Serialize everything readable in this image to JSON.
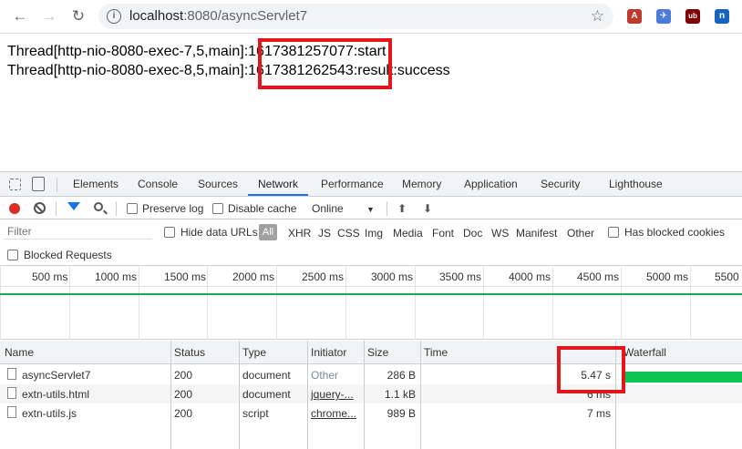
{
  "browser": {
    "url_host": "localhost",
    "url_path": ":8080/asyncServlet7",
    "back_glyph": "←",
    "forward_glyph": "→",
    "reload_glyph": "↻",
    "info_glyph": "i",
    "star_glyph": "☆",
    "extensions": [
      {
        "icon": "pdf-extension-icon",
        "color": "#c0392b",
        "glyph": "A"
      },
      {
        "icon": "vpn-extension-icon",
        "color": "#4a7bdc",
        "glyph": "✈"
      },
      {
        "icon": "ublock-extension-icon",
        "color": "#800000",
        "glyph": "ub"
      },
      {
        "icon": "app-extension-icon",
        "color": "#1565c0",
        "glyph": "n"
      }
    ]
  },
  "page": {
    "lines": [
      "Thread[http-nio-8080-exec-7,5,main]:1617381257077:start",
      "Thread[http-nio-8080-exec-8,5,main]:1617381262543:result:success"
    ]
  },
  "devtools": {
    "tabs": [
      "Elements",
      "Console",
      "Sources",
      "Network",
      "Performance",
      "Memory",
      "Application",
      "Security",
      "Lighthouse"
    ],
    "active_tab": "Network",
    "toolbar": {
      "preserve_log": "Preserve log",
      "disable_cache": "Disable cache",
      "throttle": "Online",
      "dropdown_glyph": "▼",
      "import_glyph": "⬆",
      "export_glyph": "⬇"
    },
    "filter": {
      "placeholder": "Filter",
      "hide_data_urls": "Hide data URLs",
      "all": "All",
      "types": [
        "XHR",
        "JS",
        "CSS",
        "Img",
        "Media",
        "Font",
        "Doc",
        "WS",
        "Manifest",
        "Other"
      ],
      "has_blocked_cookies": "Has blocked cookies",
      "blocked_requests": "Blocked Requests"
    },
    "overview": {
      "ticks": [
        "500 ms",
        "1000 ms",
        "1500 ms",
        "2000 ms",
        "2500 ms",
        "3000 ms",
        "3500 ms",
        "4000 ms",
        "4500 ms",
        "5000 ms",
        "5500"
      ]
    },
    "table": {
      "columns": [
        "Name",
        "Status",
        "Type",
        "Initiator",
        "Size",
        "Time",
        "Waterfall"
      ],
      "rows": [
        {
          "name": "asyncServlet7",
          "status": "200",
          "type": "document",
          "initiator": "Other",
          "size": "286 B",
          "time": "5.47 s"
        },
        {
          "name": "extn-utils.html",
          "status": "200",
          "type": "document",
          "initiator": "jquery-...",
          "size": "1.1 kB",
          "time": "6 ms"
        },
        {
          "name": "extn-utils.js",
          "status": "200",
          "type": "script",
          "initiator": "chrome...",
          "size": "989 B",
          "time": "7 ms"
        }
      ]
    }
  },
  "colors": {
    "highlight": "#e3161c",
    "accent": "#1a73e8",
    "record": "#d93025",
    "waterfall": "#0cc452"
  }
}
